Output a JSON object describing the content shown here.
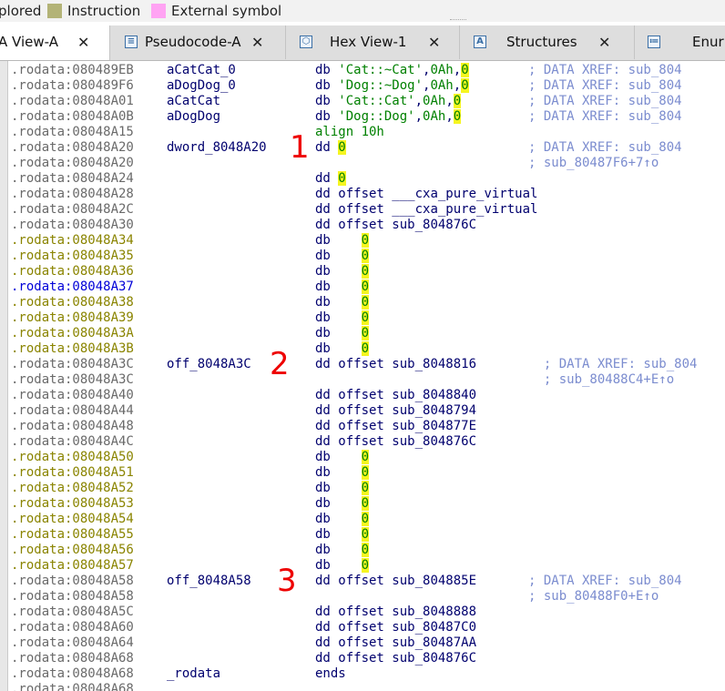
{
  "legend": {
    "items": [
      {
        "label": "plored",
        "color": ""
      },
      {
        "label": "Instruction",
        "color": "#b3b377"
      },
      {
        "label": "External symbol",
        "color": "#ffa3f3"
      }
    ]
  },
  "tabs": [
    {
      "label": "A View-A",
      "icon": "ida-view-icon",
      "active": true
    },
    {
      "label": "Pseudocode-A",
      "icon": "pseudocode-icon",
      "active": false
    },
    {
      "label": "Hex View-1",
      "icon": "hex-view-icon",
      "active": false
    },
    {
      "label": "Structures",
      "icon": "structures-icon",
      "active": false
    },
    {
      "label": "Enur",
      "icon": "enums-icon",
      "active": false
    }
  ],
  "listing": {
    "lines": [
      {
        "addr": ".rodata:080489EB",
        "label": "aCatCat_0",
        "parts": [
          [
            "kw",
            "db "
          ],
          [
            "str",
            "'Cat::~Cat'"
          ],
          [
            "kw",
            ","
          ],
          [
            "num",
            "0Ah"
          ],
          [
            "kw",
            ","
          ],
          [
            "zero",
            "0"
          ]
        ],
        "comment": "; DATA XREF: sub_804"
      },
      {
        "addr": ".rodata:080489F6",
        "label": "aDogDog_0",
        "parts": [
          [
            "kw",
            "db "
          ],
          [
            "str",
            "'Dog::~Dog'"
          ],
          [
            "kw",
            ","
          ],
          [
            "num",
            "0Ah"
          ],
          [
            "kw",
            ","
          ],
          [
            "zero",
            "0"
          ]
        ],
        "comment": "; DATA XREF: sub_804"
      },
      {
        "addr": ".rodata:08048A01",
        "label": "aCatCat",
        "parts": [
          [
            "kw",
            "db "
          ],
          [
            "str",
            "'Cat::Cat'"
          ],
          [
            "kw",
            ","
          ],
          [
            "num",
            "0Ah"
          ],
          [
            "kw",
            ","
          ],
          [
            "zero",
            "0"
          ]
        ],
        "comment": "; DATA XREF: sub_804"
      },
      {
        "addr": ".rodata:08048A0B",
        "label": "aDogDog",
        "parts": [
          [
            "kw",
            "db "
          ],
          [
            "str",
            "'Dog::Dog'"
          ],
          [
            "kw",
            ","
          ],
          [
            "num",
            "0Ah"
          ],
          [
            "kw",
            ","
          ],
          [
            "zero",
            "0"
          ]
        ],
        "comment": "; DATA XREF: sub_804"
      },
      {
        "addr": ".rodata:08048A15",
        "label": "",
        "parts": [
          [
            "str",
            "align 10h"
          ]
        ],
        "comment": ""
      },
      {
        "addr": ".rodata:08048A20",
        "label": "dword_8048A20",
        "parts": [
          [
            "kw",
            "dd "
          ],
          [
            "zero",
            "0"
          ]
        ],
        "comment": "; DATA XREF: sub_804"
      },
      {
        "addr": ".rodata:08048A20",
        "label": "",
        "parts": [],
        "comment": "; sub_80487F6+7↑o"
      },
      {
        "addr": ".rodata:08048A24",
        "label": "",
        "parts": [
          [
            "kw",
            "dd "
          ],
          [
            "zero",
            "0"
          ]
        ],
        "comment": ""
      },
      {
        "addr": ".rodata:08048A28",
        "label": "",
        "parts": [
          [
            "kw",
            "dd offset "
          ],
          [
            "ref",
            "___cxa_pure_virtual"
          ]
        ],
        "comment": ""
      },
      {
        "addr": ".rodata:08048A2C",
        "label": "",
        "parts": [
          [
            "kw",
            "dd offset "
          ],
          [
            "ref",
            "___cxa_pure_virtual"
          ]
        ],
        "comment": ""
      },
      {
        "addr": ".rodata:08048A30",
        "label": "",
        "parts": [
          [
            "kw",
            "dd offset "
          ],
          [
            "ref",
            "sub_804876C"
          ]
        ],
        "comment": ""
      },
      {
        "addr": ".rodata:08048A34",
        "label": "",
        "gap": true,
        "parts": [
          [
            "kw",
            "db    "
          ],
          [
            "zero",
            "0"
          ]
        ],
        "comment": ""
      },
      {
        "addr": ".rodata:08048A35",
        "label": "",
        "gap": true,
        "parts": [
          [
            "kw",
            "db    "
          ],
          [
            "zero",
            "0"
          ]
        ],
        "comment": ""
      },
      {
        "addr": ".rodata:08048A36",
        "label": "",
        "gap": true,
        "parts": [
          [
            "kw",
            "db    "
          ],
          [
            "zero",
            "0"
          ]
        ],
        "comment": ""
      },
      {
        "addr": ".rodata:08048A37",
        "label": "",
        "cur": true,
        "parts": [
          [
            "kw",
            "db    "
          ],
          [
            "zero",
            "0"
          ]
        ],
        "comment": ""
      },
      {
        "addr": ".rodata:08048A38",
        "label": "",
        "gap": true,
        "parts": [
          [
            "kw",
            "db    "
          ],
          [
            "zero",
            "0"
          ]
        ],
        "comment": ""
      },
      {
        "addr": ".rodata:08048A39",
        "label": "",
        "gap": true,
        "parts": [
          [
            "kw",
            "db    "
          ],
          [
            "zero",
            "0"
          ]
        ],
        "comment": ""
      },
      {
        "addr": ".rodata:08048A3A",
        "label": "",
        "gap": true,
        "parts": [
          [
            "kw",
            "db    "
          ],
          [
            "zero",
            "0"
          ]
        ],
        "comment": ""
      },
      {
        "addr": ".rodata:08048A3B",
        "label": "",
        "gap": true,
        "parts": [
          [
            "kw",
            "db    "
          ],
          [
            "zero",
            "0"
          ]
        ],
        "comment": ""
      },
      {
        "addr": ".rodata:08048A3C",
        "label": "off_8048A3C",
        "parts": [
          [
            "kw",
            "dd offset "
          ],
          [
            "ref",
            "sub_8048816"
          ]
        ],
        "comment": "  ; DATA XREF: sub_804"
      },
      {
        "addr": ".rodata:08048A3C",
        "label": "",
        "parts": [],
        "comment": "  ; sub_80488C4+E↑o"
      },
      {
        "addr": ".rodata:08048A40",
        "label": "",
        "parts": [
          [
            "kw",
            "dd offset "
          ],
          [
            "ref",
            "sub_8048840"
          ]
        ],
        "comment": ""
      },
      {
        "addr": ".rodata:08048A44",
        "label": "",
        "parts": [
          [
            "kw",
            "dd offset "
          ],
          [
            "ref",
            "sub_8048794"
          ]
        ],
        "comment": ""
      },
      {
        "addr": ".rodata:08048A48",
        "label": "",
        "parts": [
          [
            "kw",
            "dd offset "
          ],
          [
            "ref",
            "sub_804877E"
          ]
        ],
        "comment": ""
      },
      {
        "addr": ".rodata:08048A4C",
        "label": "",
        "parts": [
          [
            "kw",
            "dd offset "
          ],
          [
            "ref",
            "sub_804876C"
          ]
        ],
        "comment": ""
      },
      {
        "addr": ".rodata:08048A50",
        "label": "",
        "gap": true,
        "parts": [
          [
            "kw",
            "db    "
          ],
          [
            "zero",
            "0"
          ]
        ],
        "comment": ""
      },
      {
        "addr": ".rodata:08048A51",
        "label": "",
        "gap": true,
        "parts": [
          [
            "kw",
            "db    "
          ],
          [
            "zero",
            "0"
          ]
        ],
        "comment": ""
      },
      {
        "addr": ".rodata:08048A52",
        "label": "",
        "gap": true,
        "parts": [
          [
            "kw",
            "db    "
          ],
          [
            "zero",
            "0"
          ]
        ],
        "comment": ""
      },
      {
        "addr": ".rodata:08048A53",
        "label": "",
        "gap": true,
        "parts": [
          [
            "kw",
            "db    "
          ],
          [
            "zero",
            "0"
          ]
        ],
        "comment": ""
      },
      {
        "addr": ".rodata:08048A54",
        "label": "",
        "gap": true,
        "parts": [
          [
            "kw",
            "db    "
          ],
          [
            "zero",
            "0"
          ]
        ],
        "comment": ""
      },
      {
        "addr": ".rodata:08048A55",
        "label": "",
        "gap": true,
        "parts": [
          [
            "kw",
            "db    "
          ],
          [
            "zero",
            "0"
          ]
        ],
        "comment": ""
      },
      {
        "addr": ".rodata:08048A56",
        "label": "",
        "gap": true,
        "parts": [
          [
            "kw",
            "db    "
          ],
          [
            "zero",
            "0"
          ]
        ],
        "comment": ""
      },
      {
        "addr": ".rodata:08048A57",
        "label": "",
        "gap": true,
        "parts": [
          [
            "kw",
            "db    "
          ],
          [
            "zero",
            "0"
          ]
        ],
        "comment": ""
      },
      {
        "addr": ".rodata:08048A58",
        "label": "off_8048A58",
        "parts": [
          [
            "kw",
            "dd offset "
          ],
          [
            "ref",
            "sub_804885E"
          ]
        ],
        "comment": "; DATA XREF: sub_804"
      },
      {
        "addr": ".rodata:08048A58",
        "label": "",
        "parts": [],
        "comment": "; sub_80488F0+E↑o"
      },
      {
        "addr": ".rodata:08048A5C",
        "label": "",
        "parts": [
          [
            "kw",
            "dd offset "
          ],
          [
            "ref",
            "sub_8048888"
          ]
        ],
        "comment": ""
      },
      {
        "addr": ".rodata:08048A60",
        "label": "",
        "parts": [
          [
            "kw",
            "dd offset "
          ],
          [
            "ref",
            "sub_80487C0"
          ]
        ],
        "comment": ""
      },
      {
        "addr": ".rodata:08048A64",
        "label": "",
        "parts": [
          [
            "kw",
            "dd offset "
          ],
          [
            "ref",
            "sub_80487AA"
          ]
        ],
        "comment": ""
      },
      {
        "addr": ".rodata:08048A68",
        "label": "",
        "parts": [
          [
            "kw",
            "dd offset "
          ],
          [
            "ref",
            "sub_804876C"
          ]
        ],
        "comment": ""
      },
      {
        "addr": ".rodata:08048A68",
        "label": "_rodata",
        "parts": [
          [
            "kw",
            "ends"
          ]
        ],
        "comment": ""
      },
      {
        "addr": ".rodata:08048A68",
        "label": "",
        "parts": [],
        "comment": ""
      }
    ]
  },
  "markers": [
    {
      "text": "1",
      "line": 5
    },
    {
      "text": "2",
      "line": 19
    },
    {
      "text": "3",
      "line": 33
    }
  ]
}
